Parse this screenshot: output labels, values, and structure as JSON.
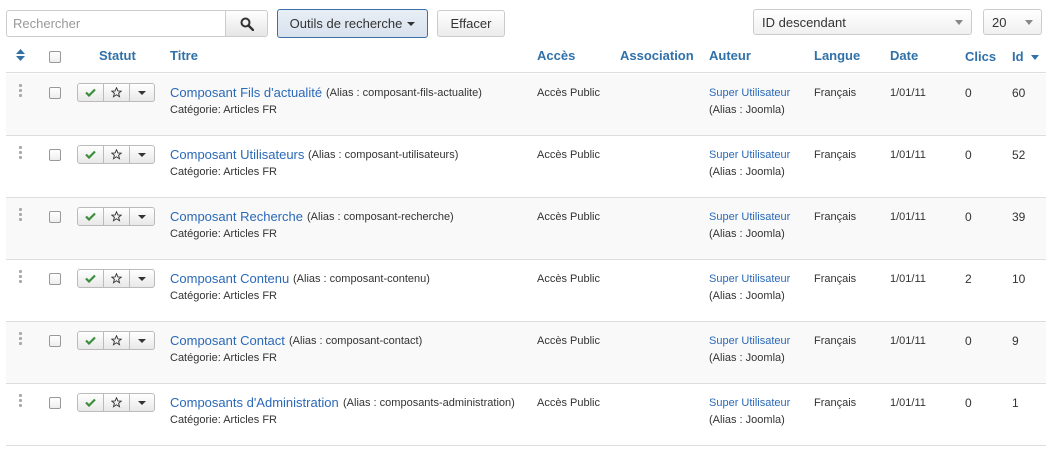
{
  "toolbar": {
    "search_placeholder": "Rechercher",
    "tools_label": "Outils de recherche",
    "clear_label": "Effacer",
    "sort_value": "ID descendant",
    "limit_value": "20"
  },
  "columns": {
    "status": "Statut",
    "title": "Titre",
    "access": "Accès",
    "association": "Association",
    "author": "Auteur",
    "language": "Langue",
    "date": "Date",
    "hits": "Clics",
    "id": "Id"
  },
  "rows": [
    {
      "title": "Composant Fils d'actualité",
      "alias": "(Alias : composant-fils-actualite)",
      "category": "Catégorie: Articles FR",
      "access": "Accès Public",
      "author": "Super Utilisateur",
      "author_alias": "(Alias : Joomla)",
      "language": "Français",
      "date": "1/01/11",
      "hits": "0",
      "id": "60"
    },
    {
      "title": "Composant Utilisateurs",
      "alias": "(Alias : composant-utilisateurs)",
      "category": "Catégorie: Articles FR",
      "access": "Accès Public",
      "author": "Super Utilisateur",
      "author_alias": "(Alias : Joomla)",
      "language": "Français",
      "date": "1/01/11",
      "hits": "0",
      "id": "52"
    },
    {
      "title": "Composant Recherche",
      "alias": "(Alias : composant-recherche)",
      "category": "Catégorie: Articles FR",
      "access": "Accès Public",
      "author": "Super Utilisateur",
      "author_alias": "(Alias : Joomla)",
      "language": "Français",
      "date": "1/01/11",
      "hits": "0",
      "id": "39"
    },
    {
      "title": "Composant Contenu",
      "alias": "(Alias : composant-contenu)",
      "category": "Catégorie: Articles FR",
      "access": "Accès Public",
      "author": "Super Utilisateur",
      "author_alias": "(Alias : Joomla)",
      "language": "Français",
      "date": "1/01/11",
      "hits": "2",
      "id": "10"
    },
    {
      "title": "Composant Contact",
      "alias": "(Alias : composant-contact)",
      "category": "Catégorie: Articles FR",
      "access": "Accès Public",
      "author": "Super Utilisateur",
      "author_alias": "(Alias : Joomla)",
      "language": "Français",
      "date": "1/01/11",
      "hits": "0",
      "id": "9"
    },
    {
      "title": "Composants d'Administration",
      "alias": "(Alias : composants-administration)",
      "category": "Catégorie: Articles FR",
      "access": "Accès Public",
      "author": "Super Utilisateur",
      "author_alias": "(Alias : Joomla)",
      "language": "Français",
      "date": "1/01/11",
      "hits": "0",
      "id": "1"
    }
  ],
  "colors": {
    "link": "#2a69b8",
    "published_check": "#3c8d3c"
  }
}
